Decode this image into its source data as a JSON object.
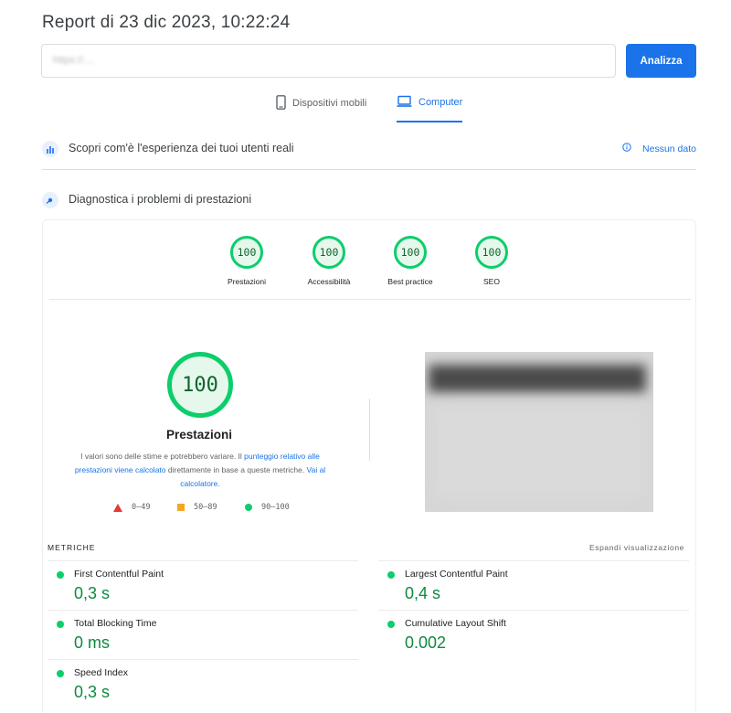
{
  "report": {
    "title": "Report di 23 dic 2023, 10:22:24"
  },
  "search": {
    "value": "https://....",
    "analyze_label": "Analizza"
  },
  "tabs": [
    {
      "label": "Dispositivi mobili",
      "icon": "smartphone-icon",
      "active": false
    },
    {
      "label": "Computer",
      "icon": "laptop-icon",
      "active": true
    }
  ],
  "crux": {
    "title": "Scopri com'è l'esperienza dei tuoi utenti reali",
    "status": "Nessun dato"
  },
  "diagnostics": {
    "title": "Diagnostica i problemi di prestazioni"
  },
  "scores": [
    {
      "value": "100",
      "label": "Prestazioni"
    },
    {
      "value": "100",
      "label": "Accessibilità"
    },
    {
      "value": "100",
      "label": "Best practice"
    },
    {
      "value": "100",
      "label": "SEO"
    }
  ],
  "performance": {
    "score": "100",
    "label": "Prestazioni",
    "disclaimer_1": "I valori sono delle stime e potrebbero variare. Il ",
    "disclaimer_link_1": "punteggio relativo alle prestazioni viene calcolato",
    "disclaimer_2": " direttamente in base a queste metriche. ",
    "disclaimer_link_2": "Vai al calcolatore",
    "disclaimer_3": "."
  },
  "legend": [
    {
      "shape": "triangle",
      "label": "0–49",
      "color": "#e53935"
    },
    {
      "shape": "square",
      "label": "50–89",
      "color": "#f6a623"
    },
    {
      "shape": "circle",
      "label": "90–100",
      "color": "#0cce6b"
    }
  ],
  "metrics_section": {
    "heading": "METRICHE",
    "expand": "Espandi visualizzazione"
  },
  "metrics": [
    {
      "name": "First Contentful Paint",
      "value": "0,3 s"
    },
    {
      "name": "Largest Contentful Paint",
      "value": "0,4 s"
    },
    {
      "name": "Total Blocking Time",
      "value": "0 ms"
    },
    {
      "name": "Cumulative Layout Shift",
      "value": "0.002"
    },
    {
      "name": "Speed Index",
      "value": "0,3 s"
    }
  ],
  "colors": {
    "accent": "#1a73e8",
    "pass": "#0cce6b",
    "pass_text": "#0d8a3f"
  }
}
